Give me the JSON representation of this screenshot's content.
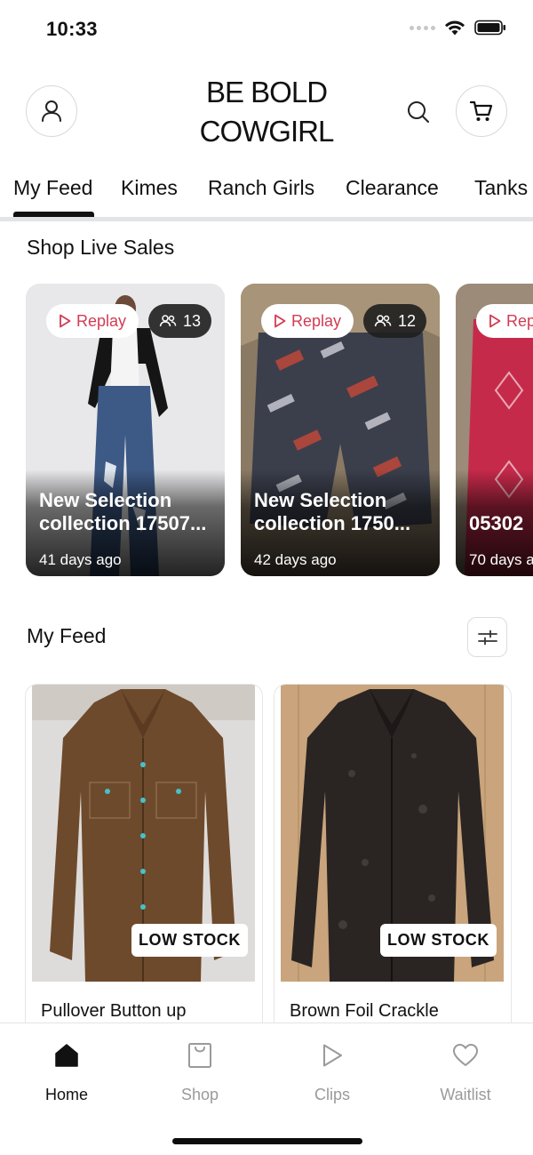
{
  "status": {
    "time": "10:33"
  },
  "header": {
    "brand_line1": "BE BOLD",
    "brand_line2": "COWGIRL",
    "profile_icon": "person-icon",
    "search_icon": "search-icon",
    "cart_icon": "cart-icon"
  },
  "tabs": [
    {
      "label": "My Feed",
      "active": true
    },
    {
      "label": "Kimes"
    },
    {
      "label": "Ranch Girls"
    },
    {
      "label": "Clearance"
    },
    {
      "label": "Tanks"
    }
  ],
  "live_sales": {
    "title": "Shop Live Sales",
    "cards": [
      {
        "replay_label": "Replay",
        "viewers": "13",
        "name_line1": "New Selection",
        "name_line2": "collection 17507...",
        "age": "41 days ago"
      },
      {
        "replay_label": "Replay",
        "viewers": "12",
        "name_line1": "New Selection",
        "name_line2": "collection 1750...",
        "age": "42 days ago"
      },
      {
        "replay_label": "Rep",
        "name_line1": "05302",
        "age": "70 days a"
      }
    ]
  },
  "feed": {
    "title": "My Feed",
    "filter_icon": "sliders-icon",
    "products": [
      {
        "name": "Pullover Button up",
        "badge": "LOW STOCK"
      },
      {
        "name": "Brown Foil Crackle",
        "badge": "LOW STOCK"
      }
    ]
  },
  "bottom_nav": [
    {
      "label": "Home",
      "icon": "home-icon",
      "active": true
    },
    {
      "label": "Shop",
      "icon": "shopping-bag-icon"
    },
    {
      "label": "Clips",
      "icon": "play-icon"
    },
    {
      "label": "Waitlist",
      "icon": "heart-icon"
    }
  ],
  "colors": {
    "accent_red": "#d23b53",
    "inactive_gray": "#9a9a9a",
    "tab_divider": "#e2e5e8"
  }
}
